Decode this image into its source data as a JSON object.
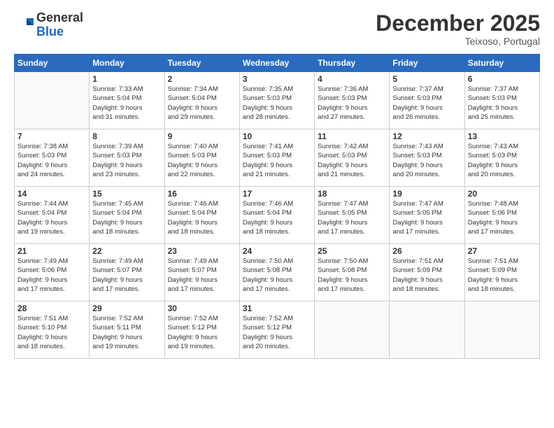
{
  "header": {
    "logo": {
      "line1": "General",
      "line2": "Blue"
    },
    "title": "December 2025",
    "subtitle": "Teixoso, Portugal"
  },
  "calendar": {
    "weekdays": [
      "Sunday",
      "Monday",
      "Tuesday",
      "Wednesday",
      "Thursday",
      "Friday",
      "Saturday"
    ],
    "weeks": [
      [
        {
          "day": "",
          "info": ""
        },
        {
          "day": "1",
          "info": "Sunrise: 7:33 AM\nSunset: 5:04 PM\nDaylight: 9 hours\nand 31 minutes."
        },
        {
          "day": "2",
          "info": "Sunrise: 7:34 AM\nSunset: 5:04 PM\nDaylight: 9 hours\nand 29 minutes."
        },
        {
          "day": "3",
          "info": "Sunrise: 7:35 AM\nSunset: 5:03 PM\nDaylight: 9 hours\nand 28 minutes."
        },
        {
          "day": "4",
          "info": "Sunrise: 7:36 AM\nSunset: 5:03 PM\nDaylight: 9 hours\nand 27 minutes."
        },
        {
          "day": "5",
          "info": "Sunrise: 7:37 AM\nSunset: 5:03 PM\nDaylight: 9 hours\nand 26 minutes."
        },
        {
          "day": "6",
          "info": "Sunrise: 7:37 AM\nSunset: 5:03 PM\nDaylight: 9 hours\nand 25 minutes."
        }
      ],
      [
        {
          "day": "7",
          "info": "Sunrise: 7:38 AM\nSunset: 5:03 PM\nDaylight: 9 hours\nand 24 minutes."
        },
        {
          "day": "8",
          "info": "Sunrise: 7:39 AM\nSunset: 5:03 PM\nDaylight: 9 hours\nand 23 minutes."
        },
        {
          "day": "9",
          "info": "Sunrise: 7:40 AM\nSunset: 5:03 PM\nDaylight: 9 hours\nand 22 minutes."
        },
        {
          "day": "10",
          "info": "Sunrise: 7:41 AM\nSunset: 5:03 PM\nDaylight: 9 hours\nand 21 minutes."
        },
        {
          "day": "11",
          "info": "Sunrise: 7:42 AM\nSunset: 5:03 PM\nDaylight: 9 hours\nand 21 minutes."
        },
        {
          "day": "12",
          "info": "Sunrise: 7:43 AM\nSunset: 5:03 PM\nDaylight: 9 hours\nand 20 minutes."
        },
        {
          "day": "13",
          "info": "Sunrise: 7:43 AM\nSunset: 5:03 PM\nDaylight: 9 hours\nand 20 minutes."
        }
      ],
      [
        {
          "day": "14",
          "info": "Sunrise: 7:44 AM\nSunset: 5:04 PM\nDaylight: 9 hours\nand 19 minutes."
        },
        {
          "day": "15",
          "info": "Sunrise: 7:45 AM\nSunset: 5:04 PM\nDaylight: 9 hours\nand 18 minutes."
        },
        {
          "day": "16",
          "info": "Sunrise: 7:46 AM\nSunset: 5:04 PM\nDaylight: 9 hours\nand 18 minutes."
        },
        {
          "day": "17",
          "info": "Sunrise: 7:46 AM\nSunset: 5:04 PM\nDaylight: 9 hours\nand 18 minutes."
        },
        {
          "day": "18",
          "info": "Sunrise: 7:47 AM\nSunset: 5:05 PM\nDaylight: 9 hours\nand 17 minutes."
        },
        {
          "day": "19",
          "info": "Sunrise: 7:47 AM\nSunset: 5:05 PM\nDaylight: 9 hours\nand 17 minutes."
        },
        {
          "day": "20",
          "info": "Sunrise: 7:48 AM\nSunset: 5:06 PM\nDaylight: 9 hours\nand 17 minutes."
        }
      ],
      [
        {
          "day": "21",
          "info": "Sunrise: 7:49 AM\nSunset: 5:06 PM\nDaylight: 9 hours\nand 17 minutes."
        },
        {
          "day": "22",
          "info": "Sunrise: 7:49 AM\nSunset: 5:07 PM\nDaylight: 9 hours\nand 17 minutes."
        },
        {
          "day": "23",
          "info": "Sunrise: 7:49 AM\nSunset: 5:07 PM\nDaylight: 9 hours\nand 17 minutes."
        },
        {
          "day": "24",
          "info": "Sunrise: 7:50 AM\nSunset: 5:08 PM\nDaylight: 9 hours\nand 17 minutes."
        },
        {
          "day": "25",
          "info": "Sunrise: 7:50 AM\nSunset: 5:08 PM\nDaylight: 9 hours\nand 17 minutes."
        },
        {
          "day": "26",
          "info": "Sunrise: 7:51 AM\nSunset: 5:09 PM\nDaylight: 9 hours\nand 18 minutes."
        },
        {
          "day": "27",
          "info": "Sunrise: 7:51 AM\nSunset: 5:09 PM\nDaylight: 9 hours\nand 18 minutes."
        }
      ],
      [
        {
          "day": "28",
          "info": "Sunrise: 7:51 AM\nSunset: 5:10 PM\nDaylight: 9 hours\nand 18 minutes."
        },
        {
          "day": "29",
          "info": "Sunrise: 7:52 AM\nSunset: 5:11 PM\nDaylight: 9 hours\nand 19 minutes."
        },
        {
          "day": "30",
          "info": "Sunrise: 7:52 AM\nSunset: 5:12 PM\nDaylight: 9 hours\nand 19 minutes."
        },
        {
          "day": "31",
          "info": "Sunrise: 7:52 AM\nSunset: 5:12 PM\nDaylight: 9 hours\nand 20 minutes."
        },
        {
          "day": "",
          "info": ""
        },
        {
          "day": "",
          "info": ""
        },
        {
          "day": "",
          "info": ""
        }
      ]
    ]
  }
}
